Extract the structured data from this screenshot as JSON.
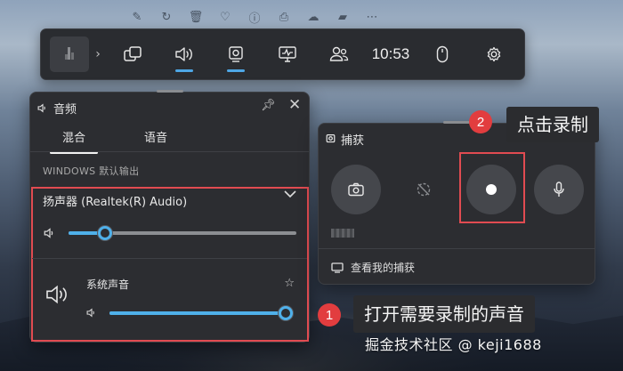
{
  "gamebar": {
    "clock": "10:53"
  },
  "audio_panel": {
    "title": "音频",
    "tabs": [
      {
        "label": "混合"
      },
      {
        "label": "语音"
      }
    ],
    "section_label": "WINDOWS 默认输出",
    "device_name": "扬声器 (Realtek(R) Audio)",
    "device_volume": 0.16,
    "app_name": "系统声音",
    "app_volume": 1.0
  },
  "capture_panel": {
    "title": "捕获",
    "gallery_link": "查看我的捕获"
  },
  "annotations": {
    "step1_number": "1",
    "step1_text": "打开需要录制的声音",
    "step2_number": "2",
    "step2_text": "点击录制"
  },
  "watermark": "掘金技术社区 @ keji1688",
  "colors": {
    "accent": "#4fb0ea",
    "highlight_red": "#e14b51",
    "badge_red": "#e23d3f",
    "panel_bg": "#2c2d31"
  }
}
